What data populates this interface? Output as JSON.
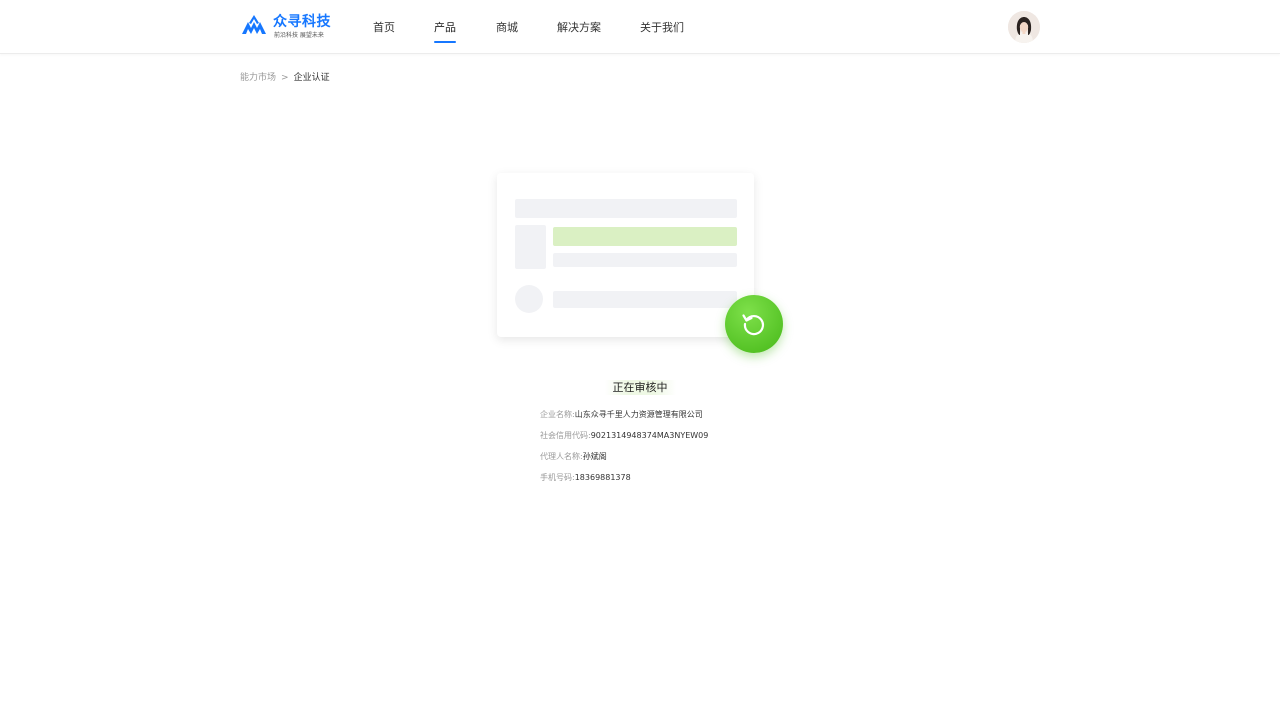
{
  "brand": {
    "name": "众寻科技",
    "slogan": "前沿科技  展望未来",
    "color": "#1677ff"
  },
  "nav": {
    "items": [
      {
        "label": "首页",
        "active": false
      },
      {
        "label": "产品",
        "active": true
      },
      {
        "label": "商城",
        "active": false
      },
      {
        "label": "解决方案",
        "active": false
      },
      {
        "label": "关于我们",
        "active": false
      }
    ]
  },
  "user": {
    "avatar_icon": "user-avatar-photo"
  },
  "breadcrumb": {
    "parent": "能力市场",
    "separator": ">",
    "current": "企业认证"
  },
  "status": {
    "title": "正在审核中",
    "icon": "refresh-icon",
    "accent_color": "#52c41a"
  },
  "details": [
    {
      "label": "企业名称:",
      "value": "山东众寻千里人力资源管理有限公司"
    },
    {
      "label": "社会信用代码:",
      "value": "9021314948374MA3NYEW09"
    },
    {
      "label": "代理人名称:",
      "value": "孙斌阁"
    },
    {
      "label": "手机号码:",
      "value": "18369881378"
    }
  ]
}
